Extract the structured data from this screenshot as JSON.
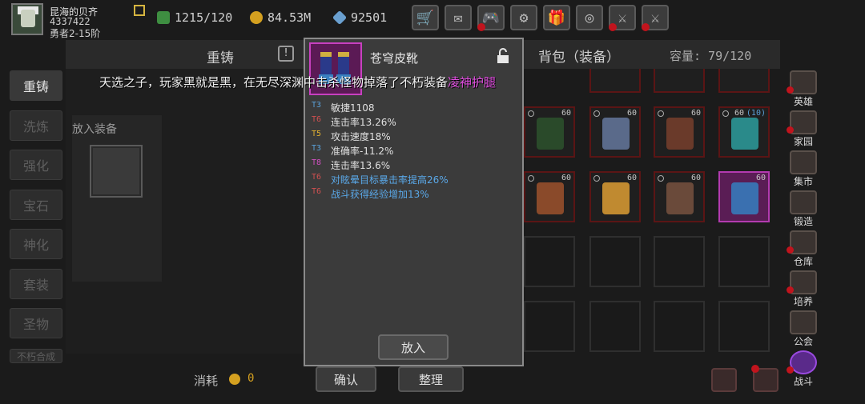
{
  "player": {
    "name": "昆海的贝齐",
    "id": "4337422",
    "rank": "勇者2-15阶"
  },
  "resources": [
    {
      "icon": "energy-icon",
      "value": "1215/120",
      "color": "#4caf50"
    },
    {
      "icon": "gold-coin-icon",
      "value": "84.53M",
      "color": "#d4a020"
    },
    {
      "icon": "gem-icon",
      "value": "92501",
      "color": "#6aa0d0"
    }
  ],
  "top_buttons": [
    {
      "icon": "shop-cart-icon",
      "glyph": "🛒",
      "badge": false
    },
    {
      "icon": "mail-icon",
      "glyph": "✉",
      "badge": false
    },
    {
      "icon": "gamepad-icon",
      "glyph": "🎮",
      "badge": true
    },
    {
      "icon": "settings-gear-icon",
      "glyph": "⚙",
      "badge": false
    },
    {
      "icon": "gift-icon",
      "glyph": "🎁",
      "badge": false
    },
    {
      "icon": "wheel-icon",
      "glyph": "◎",
      "badge": false
    },
    {
      "icon": "event-icon",
      "glyph": "⚔",
      "badge": true
    },
    {
      "icon": "battle-icon",
      "glyph": "⚔",
      "badge": true
    }
  ],
  "left_menu": [
    "重铸",
    "洗炼",
    "强化",
    "宝石",
    "神化",
    "套装",
    "圣物",
    "不朽合成"
  ],
  "panel_left": {
    "title": "重铸",
    "put_label": "放入装备",
    "consume_label": "消耗",
    "consume_value": "0",
    "confirm": "确认"
  },
  "panel_right": {
    "title": "背包（装备）",
    "capacity_label": "容量: 79/120",
    "sort": "整理"
  },
  "banner": {
    "text": "天选之子，玩家黑就是黑，在无尽深渊中击杀怪物掉落了不朽装备",
    "highlight": "凌神护腿"
  },
  "tooltip": {
    "name": "苍穹皮靴",
    "stats": [
      {
        "tier": "T3",
        "tier_color": "#5aa0d8",
        "text": "敏捷1108",
        "color": "#e0e0e0"
      },
      {
        "tier": "T6",
        "tier_color": "#d05050",
        "text": "连击率13.26%",
        "color": "#e0e0e0"
      },
      {
        "tier": "T5",
        "tier_color": "#e0b030",
        "text": "攻击速度18%",
        "color": "#e0e0e0"
      },
      {
        "tier": "T3",
        "tier_color": "#5aa0d8",
        "text": "准确率-11.2%",
        "color": "#e0e0e0"
      },
      {
        "tier": "T8",
        "tier_color": "#d050c0",
        "text": "连击率13.6%",
        "color": "#e0e0e0"
      },
      {
        "tier": "T6",
        "tier_color": "#d05050",
        "text": "对眩晕目标暴击率提高26%",
        "color": "#5aa8e8"
      },
      {
        "tier": "T6",
        "tier_color": "#d05050",
        "text": "战斗获得经验增加13%",
        "color": "#5aa8e8"
      }
    ],
    "put_in": "放入"
  },
  "inventory_rows": [
    [
      {
        "lvl": "60",
        "kind": "crossbow"
      },
      {
        "lvl": "60",
        "kind": "blade"
      },
      {
        "lvl": "60",
        "kind": "glove"
      },
      {
        "lvl": "60",
        "lvl2": "(10)",
        "kind": "amulet"
      }
    ],
    [
      {
        "lvl": "60",
        "kind": "pants"
      },
      {
        "lvl": "60",
        "kind": "armor"
      },
      {
        "lvl": "60",
        "kind": "pants2"
      },
      {
        "lvl": "60",
        "kind": "boots",
        "purple": true
      }
    ]
  ],
  "right_menu": [
    {
      "label": "英雄",
      "icon": "hero-icon",
      "badge": true
    },
    {
      "label": "家园",
      "icon": "home-icon",
      "badge": true
    },
    {
      "label": "集市",
      "icon": "market-icon",
      "badge": false
    },
    {
      "label": "锻造",
      "icon": "forge-icon",
      "badge": false
    },
    {
      "label": "仓库",
      "icon": "warehouse-icon",
      "badge": true
    },
    {
      "label": "培养",
      "icon": "train-icon",
      "badge": true
    },
    {
      "label": "公会",
      "icon": "guild-icon",
      "badge": false
    },
    {
      "label": "战斗",
      "icon": "battle-portal-icon",
      "badge": true
    }
  ]
}
